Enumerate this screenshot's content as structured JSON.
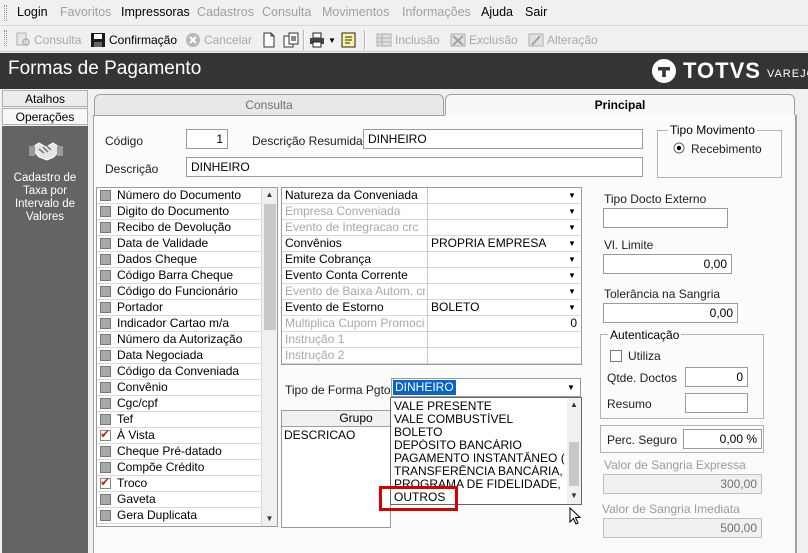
{
  "menu": {
    "items": [
      {
        "label": "Login",
        "enabled": true
      },
      {
        "label": "Favoritos",
        "enabled": false
      },
      {
        "label": "Impressoras",
        "enabled": true
      },
      {
        "label": "Cadastros",
        "enabled": false
      },
      {
        "label": "Consulta",
        "enabled": false
      },
      {
        "label": "Movimentos",
        "enabled": false
      },
      {
        "label": "Informações",
        "enabled": false
      },
      {
        "label": "Ajuda",
        "enabled": true
      },
      {
        "label": "Sair",
        "enabled": true
      }
    ]
  },
  "toolbar": {
    "consulta_label": "Consulta",
    "confirmacao_label": "Confirmação",
    "cancelar_label": "Cancelar",
    "inclusao_label": "Inclusão",
    "exclusao_label": "Exclusão",
    "alteracao_label": "Alteração"
  },
  "title": {
    "text": "Formas de Pagamento",
    "brand": "TOTVS",
    "brand_sub": "VAREJO"
  },
  "left_panel": {
    "atalhos_label": "Atalhos",
    "operacoes_label": "Operações",
    "cadastro_taxa_label": "Cadastro de Taxa por Intervalo de Valores"
  },
  "tabs": {
    "consulta": "Consulta",
    "principal": "Principal"
  },
  "form": {
    "codigo_label": "Código",
    "codigo_value": "1",
    "descricao_resumida_label": "Descrição Resumida",
    "descricao_resumida_value": "DINHEIRO",
    "descricao_label": "Descrição",
    "descricao_value": "DINHEIRO",
    "tipo_movimento_label": "Tipo Movimento",
    "recebimento_label": "Recebimento"
  },
  "checklist": [
    {
      "label": "Número do Documento",
      "checked": false
    },
    {
      "label": "Digito do Documento",
      "checked": false
    },
    {
      "label": "Recibo de Devolução",
      "checked": false
    },
    {
      "label": "Data de Validade",
      "checked": false
    },
    {
      "label": "Dados Cheque",
      "checked": false
    },
    {
      "label": "Código Barra Cheque",
      "checked": false
    },
    {
      "label": "Código do Funcionário",
      "checked": false
    },
    {
      "label": "Portador",
      "checked": false
    },
    {
      "label": "Indicador Cartao m/a",
      "checked": false
    },
    {
      "label": "Número da Autorização",
      "checked": false
    },
    {
      "label": "Data Negociada",
      "checked": false
    },
    {
      "label": "Código da Conveniada",
      "checked": false
    },
    {
      "label": "Convênio",
      "checked": false
    },
    {
      "label": "Cgc/cpf",
      "checked": false
    },
    {
      "label": "Tef",
      "checked": false
    },
    {
      "label": "À Vista",
      "checked": true
    },
    {
      "label": "Cheque Pré-datado",
      "checked": false
    },
    {
      "label": "Compõe Crédito",
      "checked": false
    },
    {
      "label": "Troco",
      "checked": true
    },
    {
      "label": "Gaveta",
      "checked": false
    },
    {
      "label": "Gera Duplicata",
      "checked": false
    }
  ],
  "propgrid": [
    {
      "name": "Natureza da Conveniada",
      "value": "",
      "enabled": true,
      "dropdown": true
    },
    {
      "name": "Empresa Conveniada",
      "value": "",
      "enabled": false,
      "dropdown": true
    },
    {
      "name": "Evento de Integracao crc",
      "value": "",
      "enabled": false,
      "dropdown": true
    },
    {
      "name": "Convênios",
      "value": "PROPRIA EMPRESA",
      "enabled": true,
      "dropdown": true
    },
    {
      "name": "Emite Cobrança",
      "value": "",
      "enabled": true,
      "dropdown": true
    },
    {
      "name": "Evento Conta Corrente",
      "value": "",
      "enabled": true,
      "dropdown": true
    },
    {
      "name": "Evento de Baixa Autom. crc",
      "value": "",
      "enabled": false,
      "dropdown": true
    },
    {
      "name": "Evento de Estorno",
      "value": "BOLETO",
      "enabled": true,
      "dropdown": true
    },
    {
      "name": "Multiplica Cupom Promocional",
      "value": "0",
      "enabled": false,
      "dropdown": false
    },
    {
      "name": "Instrução 1",
      "value": "",
      "enabled": false,
      "dropdown": false
    },
    {
      "name": "Instrução 2",
      "value": "",
      "enabled": false,
      "dropdown": false
    }
  ],
  "tipo_forma_pgto": {
    "label": "Tipo de Forma Pgto",
    "selected": "DINHEIRO",
    "options": [
      "VALE PRESENTE",
      "VALE COMBUSTÍVEL",
      "BOLETO",
      "DEPÓSITO BANCÁRIO",
      "PAGAMENTO INSTANTÂNEO (PIX)",
      "TRANSFERÊNCIA BANCÁRIA, CAR",
      "PROGRAMA DE FIDELIDADE, CAS",
      "OUTROS"
    ],
    "highlight_color": "#d90000"
  },
  "grupo_table": {
    "header": "Grupo",
    "row": "DESCRICAO"
  },
  "right": {
    "tipo_docto_externo_label": "Tipo Docto Externo",
    "tipo_docto_externo_value": "",
    "vl_limite_label": "Vl. Limite",
    "vl_limite_value": "0,00",
    "tolerancia_label": "Tolerância na Sangria",
    "tolerancia_value": "0,00",
    "autenticacao_label": "Autenticação",
    "utiliza_label": "Utiliza",
    "qtde_doctos_label": "Qtde. Doctos",
    "qtde_doctos_value": "0",
    "resumo_label": "Resumo",
    "resumo_value": "",
    "perc_seguro_label": "Perc. Seguro",
    "perc_seguro_value": "0,00 %",
    "sangria_expressa_label": "Valor de Sangria Expressa",
    "sangria_expressa_value": "300,00",
    "sangria_imediata_label": "Valor de Sangria Imediata",
    "sangria_imediata_value": "500,00"
  }
}
